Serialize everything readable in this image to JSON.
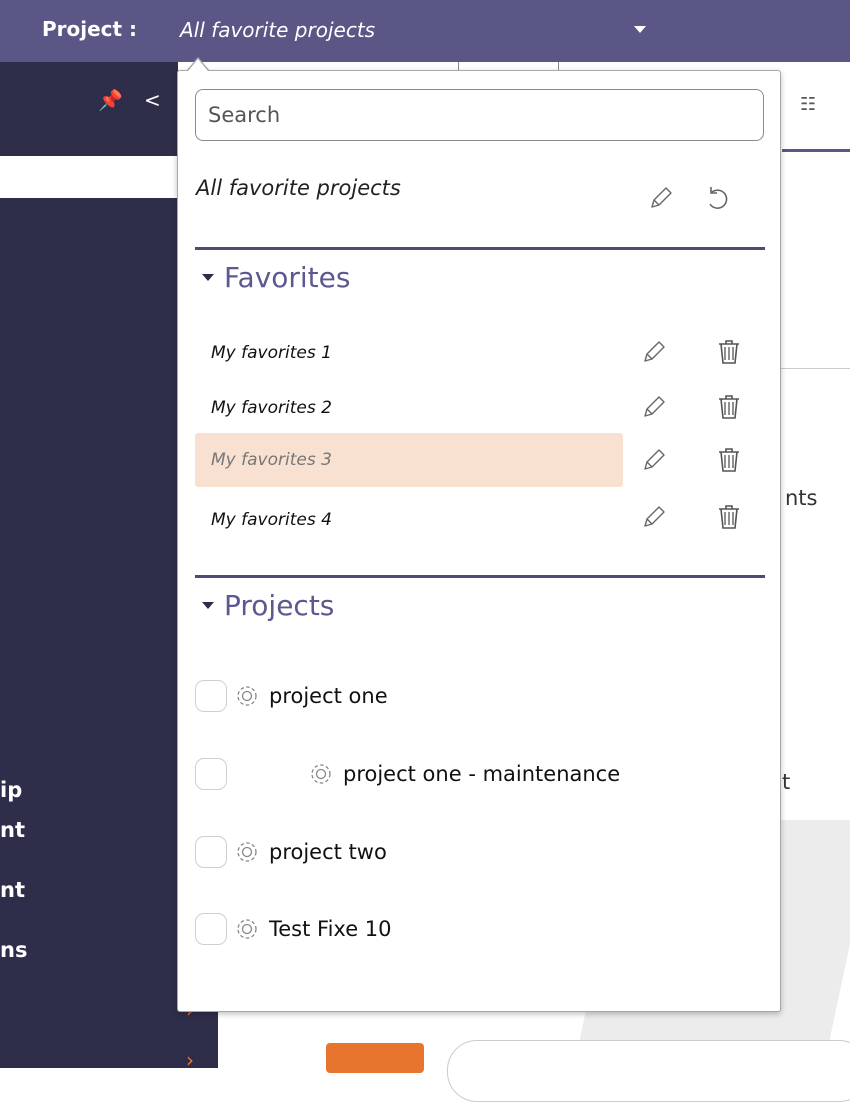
{
  "header": {
    "project_label": "Project :",
    "project_value": "All favorite projects"
  },
  "sidebar_fragments": [
    "ip",
    "nt",
    "nt",
    "ns"
  ],
  "background_fragments": {
    "nts": "nts",
    "t": "t"
  },
  "dropdown": {
    "search": {
      "placeholder": "Search",
      "value": ""
    },
    "current_selection": "All favorite projects",
    "favorites": {
      "title": "Favorites",
      "items": [
        {
          "label": "My favorites 1",
          "selected": false
        },
        {
          "label": "My favorites 2",
          "selected": false
        },
        {
          "label": "My favorites 3",
          "selected": true
        },
        {
          "label": "My favorites 4",
          "selected": false
        }
      ]
    },
    "projects": {
      "title": "Projects",
      "items": [
        {
          "label": "project one",
          "checked": false,
          "indent_level": 0
        },
        {
          "label": "project one - maintenance",
          "checked": false,
          "indent_level": 1
        },
        {
          "label": "project two",
          "checked": false,
          "indent_level": 0
        },
        {
          "label": "Test Fixe 10",
          "checked": false,
          "indent_level": 0
        }
      ]
    }
  },
  "icons": {
    "edit": "pencil-icon",
    "reset": "reset-icon",
    "delete": "trash-icon",
    "settings": "gear-icon",
    "pin": "pin-icon",
    "collapse": "collapse-icon",
    "tree": "tree-icon"
  },
  "colors": {
    "header_bg": "#5a5685",
    "sidebar_bg": "#2f2e4a",
    "section_title": "#5c5890",
    "selected_row": "#f9e1d2",
    "accent_orange": "#e8752e",
    "divider": "#4e4b75"
  }
}
